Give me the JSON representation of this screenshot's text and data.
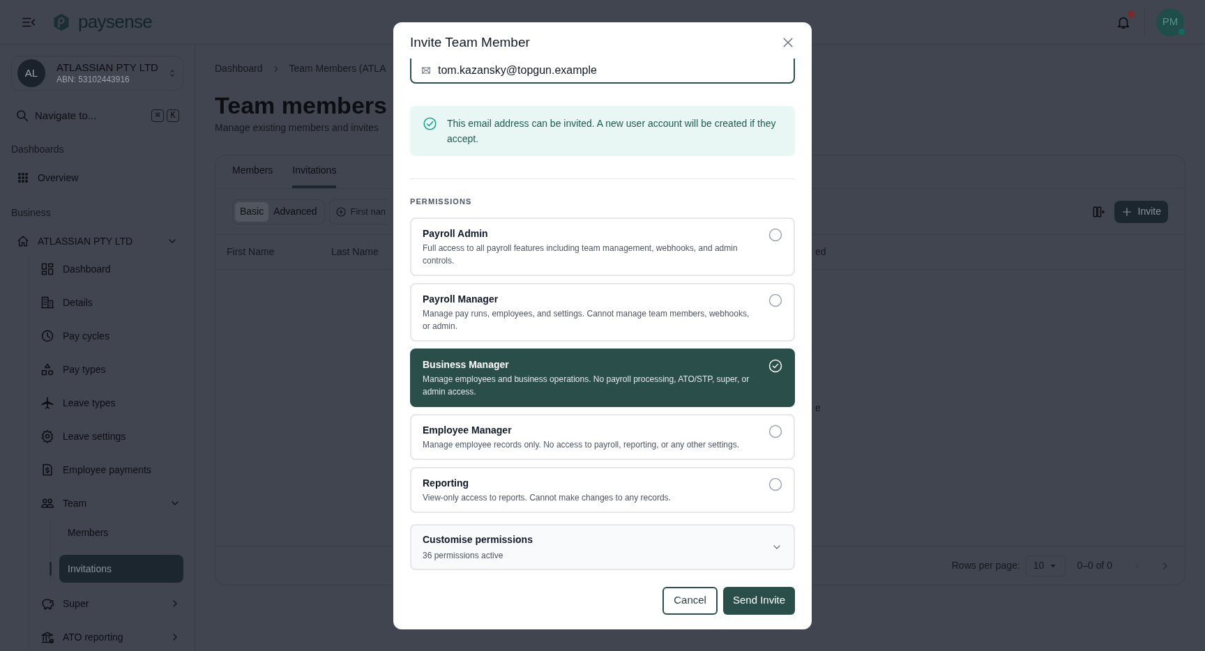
{
  "header": {
    "logo_text": "paysense",
    "notification_unread": true,
    "avatar": {
      "initials": "PM",
      "online": true
    }
  },
  "sidebar": {
    "org": {
      "initials": "AL",
      "name": "ATLASSIAN PTY LTD",
      "abn": "ABN: 53102443916"
    },
    "search": {
      "placeholder": "Navigate to...",
      "keys": [
        "⌘",
        "K"
      ]
    },
    "sections": [
      {
        "title": "Dashboards",
        "items": [
          {
            "label": "Overview",
            "selected": false
          }
        ]
      },
      {
        "title": "Business",
        "items": [
          {
            "label": "ATLASSIAN PTY LTD",
            "selected": false,
            "expanded": true,
            "children": [
              {
                "label": "Dashboard",
                "selected": false
              },
              {
                "label": "Details",
                "selected": false
              },
              {
                "label": "Pay cycles",
                "selected": false
              },
              {
                "label": "Pay types",
                "selected": false
              },
              {
                "label": "Leave types",
                "selected": false
              },
              {
                "label": "Leave settings",
                "selected": false
              },
              {
                "label": "Employee payments",
                "selected": false
              },
              {
                "label": "Team",
                "selected": false,
                "expanded": true,
                "children": [
                  {
                    "label": "Members",
                    "selected": false
                  },
                  {
                    "label": "Invitations",
                    "selected": true
                  }
                ]
              },
              {
                "label": "Super",
                "selected": false,
                "expanded": false
              },
              {
                "label": "ATO reporting",
                "selected": false,
                "expanded": false
              }
            ]
          }
        ]
      }
    ]
  },
  "main": {
    "breadcrumb": [
      "Dashboard",
      "Team Members (ATLA"
    ],
    "title": "Team members",
    "subtitle": "Manage existing members and invites",
    "tabs": [
      {
        "label": "Members",
        "selected": false
      },
      {
        "label": "Invitations",
        "selected": true
      }
    ],
    "mode": [
      {
        "label": "Basic",
        "selected": true
      },
      {
        "label": "Advanced",
        "selected": false
      }
    ],
    "filter_placeholder": "First nan",
    "invite_button": "Invite",
    "table": {
      "columns": [
        "First Name",
        "Last Name",
        "ed"
      ],
      "empty_text": "e"
    },
    "pagination": {
      "rows_label": "Rows per page:",
      "rows_value": "10",
      "range": "0–0 of 0",
      "prev_disabled": true,
      "next_disabled": false
    }
  },
  "modal": {
    "title": "Invite Team Member",
    "email": "tom.kazansky@topgun.example",
    "alert": {
      "kind": "success",
      "text": "This email address can be invited. A new user account will be created if they accept."
    },
    "section_label": "PERMISSIONS",
    "options": [
      {
        "title": "Payroll Admin",
        "description": "Full access to all payroll features including team management, webhooks, and admin controls.",
        "selected": false
      },
      {
        "title": "Payroll Manager",
        "description": "Manage pay runs, employees, and settings. Cannot manage team members, webhooks, or admin.",
        "selected": false
      },
      {
        "title": "Business Manager",
        "description": "Manage employees and business operations. No payroll processing, ATO/STP, super, or admin access.",
        "selected": true
      },
      {
        "title": "Employee Manager",
        "description": "Manage employee records only. No access to payroll, reporting, or any other settings.",
        "selected": false
      },
      {
        "title": "Reporting",
        "description": "View-only access to reports. Cannot make changes to any records.",
        "selected": false
      }
    ],
    "customise": {
      "title": "Customise permissions",
      "subtitle": "36 permissions active",
      "expanded": false
    },
    "buttons": [
      {
        "label": "Cancel",
        "kind": "secondary"
      },
      {
        "label": "Send Invite",
        "kind": "primary"
      }
    ]
  }
}
